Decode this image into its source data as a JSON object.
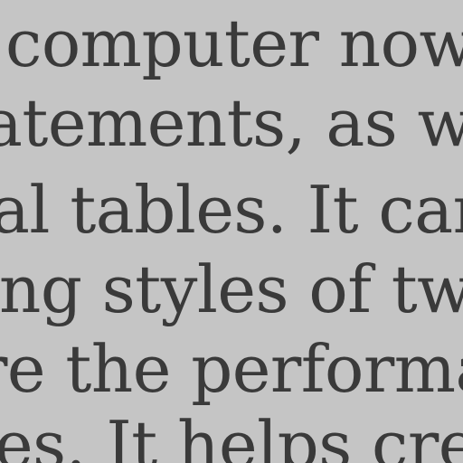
{
  "document": {
    "lines": [
      "computer now",
      "atements, as we",
      "al tables. It can h",
      "ting styles of tw",
      "re the performa",
      "es. It helps crea"
    ]
  }
}
